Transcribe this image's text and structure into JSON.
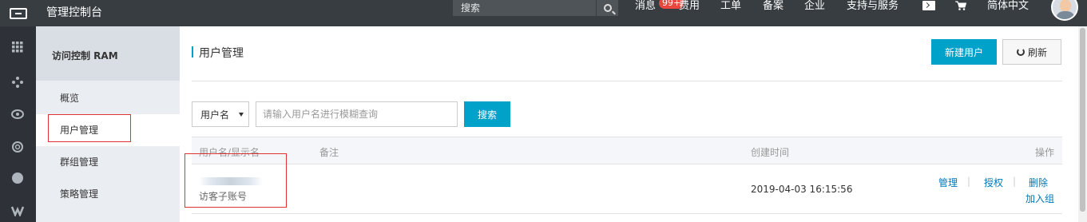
{
  "topbar": {
    "logo": "aliyun-logo",
    "console_title": "管理控制台",
    "search_placeholder": "搜索",
    "nav": {
      "messages": "消息",
      "messages_badge": "99+",
      "billing": "费用",
      "tickets": "工单",
      "icp": "备案",
      "enterprise": "企业",
      "support": "支持与服务",
      "language": "简体中文"
    }
  },
  "iconbar": {
    "icons": [
      "grid-icon",
      "products-icon",
      "eye-icon",
      "cloud-ring-icon",
      "dot-icon",
      "wave-icon"
    ]
  },
  "sidebar": {
    "header": "访问控制 RAM",
    "items": [
      {
        "label": "概览"
      },
      {
        "label": "用户管理",
        "active": true
      },
      {
        "label": "群组管理"
      },
      {
        "label": "策略管理"
      }
    ]
  },
  "main": {
    "title": "用户管理",
    "new_user_label": "新建用户",
    "refresh_label": "刷新",
    "filter_select_value": "用户名",
    "query_placeholder": "请输入用户名进行模糊查询",
    "search_label": "搜索",
    "table": {
      "columns": [
        "用户名/显示名",
        "备注",
        "创建时间",
        "操作"
      ],
      "rows": [
        {
          "display_name": "访客子账号",
          "note": "",
          "created": "2019-04-03 16:15:56",
          "actions": [
            "管理",
            "授权",
            "删除",
            "加入组"
          ]
        }
      ]
    }
  },
  "colors": {
    "topbar_bg": "#373d41",
    "accent": "#00a2ca",
    "link": "#0077b8",
    "highlight_box": "#e03434"
  }
}
